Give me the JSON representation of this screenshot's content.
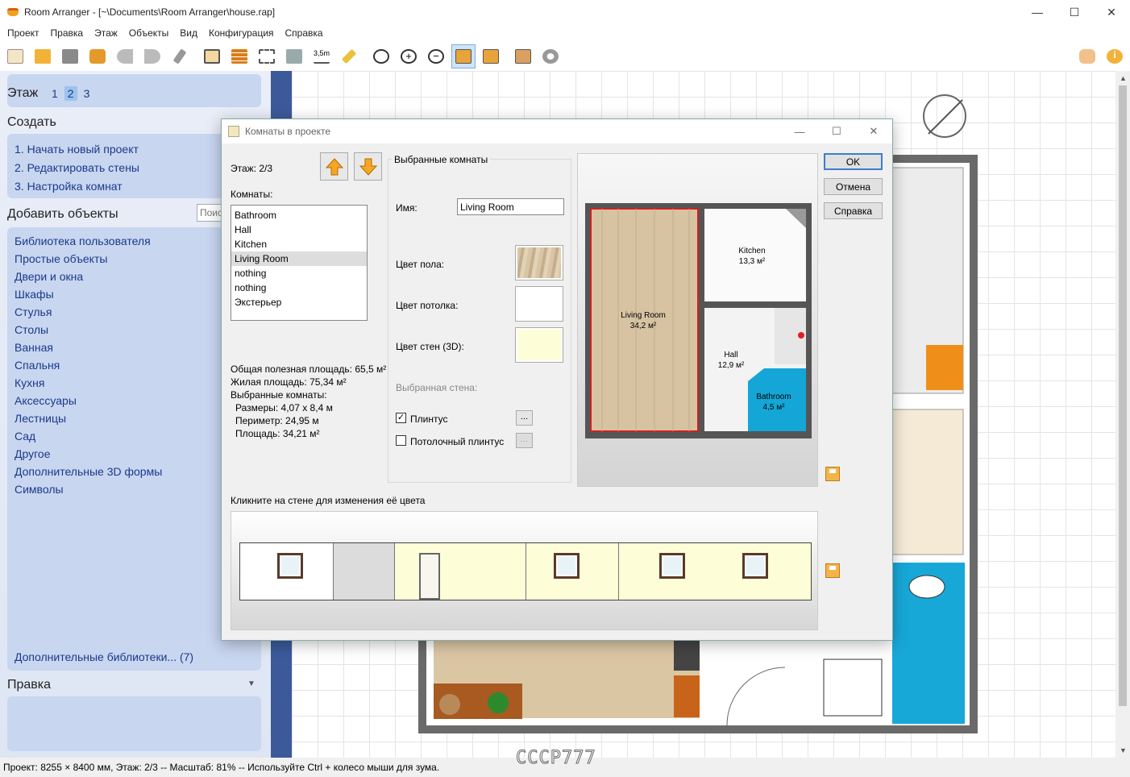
{
  "window": {
    "title": "Room Arranger - [~\\Documents\\Room Arranger\\house.rap]"
  },
  "menu": [
    "Проект",
    "Правка",
    "Этаж",
    "Объекты",
    "Вид",
    "Конфигурация",
    "Справка"
  ],
  "left_panel": {
    "floor_label": "Этаж",
    "floors": [
      "1",
      "2",
      "3"
    ],
    "selected_floor": "2",
    "create_header": "Создать",
    "create_items": [
      "1. Начать новый проект",
      "2. Редактировать стены",
      "3. Настройка комнат"
    ],
    "add_header": "Добавить объекты",
    "search_placeholder": "Поиск",
    "categories": [
      "Библиотека пользователя",
      "Простые объекты",
      "Двери и окна",
      "Шкафы",
      "Стулья",
      "Столы",
      "Ванная",
      "Спальня",
      "Кухня",
      "Аксессуары",
      "Лестницы",
      "Сад",
      "Другое",
      "Дополнительные 3D формы",
      "Символы"
    ],
    "more_libraries": "Дополнительные библиотеки... (7)",
    "edit_header": "Правка"
  },
  "dialog": {
    "title": "Комнаты в проекте",
    "floor": "Этаж: 2/3",
    "rooms_label": "Комнаты:",
    "rooms": [
      "Bathroom",
      "Hall",
      "Kitchen",
      "Living Room",
      "nothing",
      "nothing",
      "Экстерьер"
    ],
    "selected_room": "Living Room",
    "group_title": "Выбранные комнаты",
    "name_label": "Имя:",
    "name_value": "Living Room",
    "floor_color_label": "Цвет пола:",
    "ceiling_color_label": "Цвет потолка:",
    "wall_color_label": "Цвет стен (3D):",
    "ceiling_color": "#ffffff",
    "wall_color": "#fdfdd8",
    "selected_wall_label": "Выбранная стена:",
    "baseboard_label": "Плинтус",
    "baseboard_checked": true,
    "ceiling_baseboard_label": "Потолочный плинтус",
    "ceiling_baseboard_checked": false,
    "dots": "...",
    "stats": {
      "total_area": "Общая полезная площадь: 65,5 м²",
      "living_area": "Жилая площадь: 75,34 м²",
      "selected_rooms": "Выбранные комнаты:",
      "dimensions": "Размеры: 4,07 x 8,4 м",
      "perimeter": "Периметр: 24,95 м",
      "area": "Площадь: 34,21 м²"
    },
    "preview_rooms": [
      {
        "name": "Living Room",
        "area": "34,2 м²"
      },
      {
        "name": "Kitchen",
        "area": "13,3 м²"
      },
      {
        "name": "Hall",
        "area": "12,9 м²"
      },
      {
        "name": "Bathroom",
        "area": "4,5 м²"
      }
    ],
    "buttons": {
      "ok": "OK",
      "cancel": "Отмена",
      "help": "Справка"
    },
    "wall_hint": "Кликните на стене для изменения её цвета"
  },
  "status": "Проект: 8255 × 8400 мм, Этаж: 2/3 -- Масштаб: 81% -- Используйте Ctrl + колесо мыши для зума.",
  "watermark": "CCCP777"
}
